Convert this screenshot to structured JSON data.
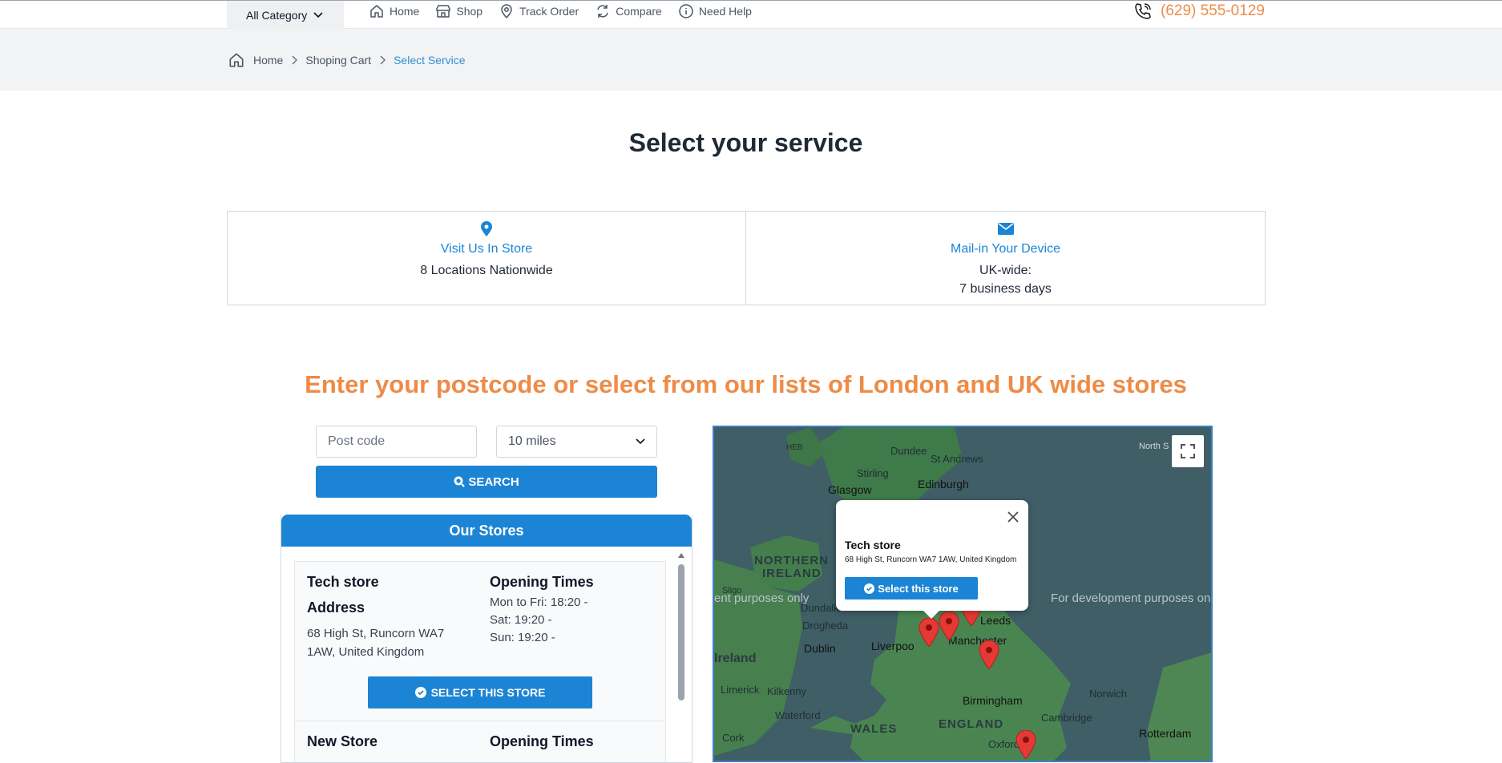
{
  "header": {
    "category_label": "All Category",
    "nav": [
      {
        "label": "Home",
        "icon": "home-icon"
      },
      {
        "label": "Shop",
        "icon": "shop-icon"
      },
      {
        "label": "Track Order",
        "icon": "location-pin-icon"
      },
      {
        "label": "Compare",
        "icon": "compare-icon"
      },
      {
        "label": "Need Help",
        "icon": "info-icon"
      }
    ],
    "phone": "(629) 555-0129"
  },
  "breadcrumb": {
    "items": [
      "Home",
      "Shoping Cart",
      "Select Service"
    ]
  },
  "page_title": "Select your service",
  "services": [
    {
      "title": "Visit Us In Store",
      "line1": "8 Locations Nationwide",
      "line2": "",
      "icon": "map-marker-icon"
    },
    {
      "title": "Mail-in Your Device",
      "line1": "UK-wide:",
      "line2": "7 business days",
      "icon": "envelope-icon"
    }
  ],
  "finder": {
    "heading": "Enter your postcode or select from our lists of London and UK wide stores",
    "postcode_placeholder": "Post code",
    "radius_selected": "10 miles",
    "search_label": "SEARCH"
  },
  "stores_panel": {
    "title": "Our Stores",
    "address_heading": "Address",
    "opening_heading": "Opening Times",
    "select_label": "SELECT THIS STORE",
    "stores": [
      {
        "name": "Tech store",
        "address": "68 High St, Runcorn WA7 1AW, United Kingdom",
        "times": [
          "Mon to Fri: 18:20 -",
          "Sat: 19:20 -",
          "Sun: 19:20 -"
        ]
      },
      {
        "name": "New Store"
      }
    ]
  },
  "map": {
    "labels": {
      "dundee": "Dundee",
      "st_andrews": "St Andrews",
      "stirling": "Stirling",
      "glasgow": "Glasgow",
      "edinburgh": "Edinburgh",
      "northern_ireland_1": "NORTHERN",
      "northern_ireland_2": "IRELAND",
      "dundalk": "Dundalk",
      "drogheda": "Drogheda",
      "dublin": "Dublin",
      "ireland": "Ireland",
      "limerick": "Limerick",
      "kilkenny": "Kilkenny",
      "waterford": "Waterford",
      "cork": "Cork",
      "liverpool": "Liverpoo",
      "manchester": "Manchester",
      "leeds": "Leeds",
      "birmingham": "Birmingham",
      "norwich": "Norwich",
      "cambridge": "Cambridge",
      "oxford": "Oxford",
      "wales": "WALES",
      "england": "ENGLAND",
      "rotterdam": "Rotterdam",
      "north_sea": "North S",
      "hebrides": "HEB",
      "sligo": "Sligo"
    },
    "dev_text_left": "ent purposes only",
    "dev_text_right": "For development purposes on",
    "popup": {
      "name": "Tech store",
      "address": "68 High St, Runcorn WA7 1AW, United Kingdom",
      "button_label": "Select this store"
    }
  },
  "colors": {
    "brand_blue": "#1c84d4",
    "accent_orange": "#ee8b47",
    "marker_red": "#e53935"
  }
}
